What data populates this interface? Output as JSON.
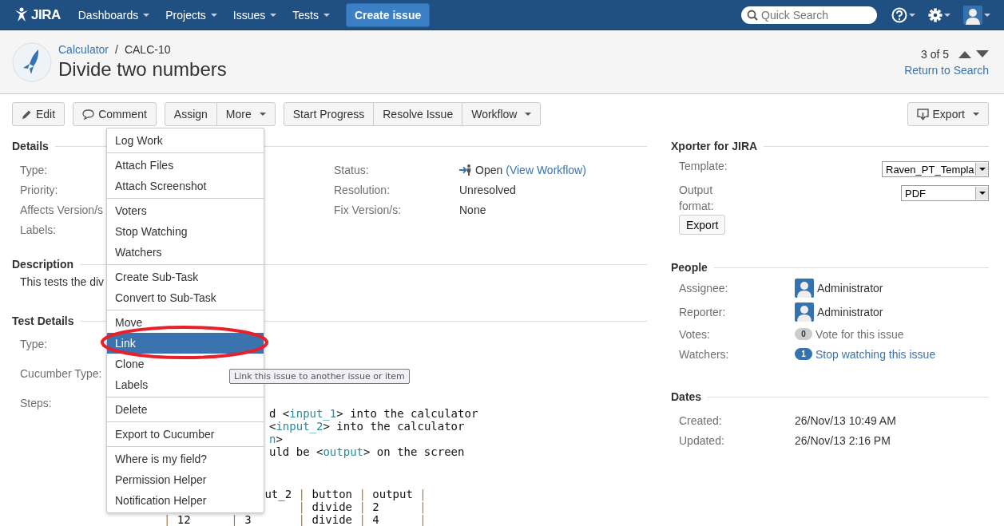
{
  "nav": {
    "logo": "JIRA",
    "items": [
      {
        "label": "Dashboards"
      },
      {
        "label": "Projects"
      },
      {
        "label": "Issues"
      },
      {
        "label": "Tests"
      }
    ],
    "create": "Create issue",
    "search": {
      "placeholder": "Quick Search"
    }
  },
  "header": {
    "project": "Calculator",
    "separator": "/",
    "key": "CALC-10",
    "title": "Divide two numbers",
    "pager": "3 of 5",
    "return_link": "Return to Search"
  },
  "toolbar": {
    "groups": [
      [
        {
          "label": "Edit",
          "kind": "edit",
          "dropdown": false
        }
      ],
      [
        {
          "label": "Comment",
          "kind": "comment",
          "dropdown": false
        }
      ],
      [
        {
          "label": "Assign",
          "dropdown": false
        },
        {
          "label": "More",
          "dropdown": true
        }
      ],
      [
        {
          "label": "Start Progress",
          "dropdown": false
        },
        {
          "label": "Resolve Issue",
          "dropdown": false
        },
        {
          "label": "Workflow",
          "dropdown": true
        }
      ]
    ],
    "export": {
      "label": "Export",
      "dropdown": true
    }
  },
  "details": {
    "heading": "Details",
    "left": [
      {
        "label": "Type:"
      },
      {
        "label": "Priority:"
      },
      {
        "label": "Affects Version/s"
      },
      {
        "label": "Labels:"
      }
    ],
    "right": [
      {
        "label": "Status:",
        "value": "Open",
        "link": "(View Workflow)",
        "kind": "status"
      },
      {
        "label": "Resolution:",
        "value": "Unresolved",
        "kind": "text"
      },
      {
        "label": "Fix Version/s:",
        "value": "None",
        "kind": "text"
      }
    ]
  },
  "description": {
    "heading": "Description",
    "text": "This tests the div"
  },
  "test_details": {
    "heading": "Test Details",
    "fields": [
      {
        "label": "Type:"
      },
      {
        "label": "Cucumber Type:"
      },
      {
        "label": "Steps:"
      }
    ],
    "steps": [
      {
        "kind": "step",
        "segments": [
          {
            "kind": "plain",
            "text": "d <"
          },
          {
            "kind": "var",
            "text": "input_1"
          },
          {
            "kind": "plain",
            "text": "> into the calculator"
          }
        ]
      },
      {
        "kind": "step",
        "segments": [
          {
            "kind": "plain",
            "text": "<"
          },
          {
            "kind": "var",
            "text": "input_2"
          },
          {
            "kind": "plain",
            "text": "> into the calculator"
          }
        ]
      },
      {
        "kind": "step",
        "segments": [
          {
            "kind": "var",
            "text": "n"
          },
          {
            "kind": "plain",
            "text": ">"
          }
        ]
      },
      {
        "kind": "step",
        "segments": [
          {
            "kind": "plain",
            "text": "uld be <"
          },
          {
            "kind": "var",
            "text": "output"
          },
          {
            "kind": "plain",
            "text": "> on the screen"
          }
        ]
      }
    ],
    "table": [
      [
        {
          "kind": "plain",
          "text": "ut_2 "
        },
        {
          "kind": "pipe",
          "text": "|"
        },
        {
          "kind": "plain",
          "text": " button "
        },
        {
          "kind": "pipe",
          "text": "|"
        },
        {
          "kind": "plain",
          "text": " output "
        },
        {
          "kind": "pipe",
          "text": "|"
        }
      ],
      [
        {
          "kind": "pipe",
          "text": "|"
        },
        {
          "kind": "plain",
          "text": " divide "
        },
        {
          "kind": "pipe",
          "text": "|"
        },
        {
          "kind": "plain",
          "text": " 2      "
        },
        {
          "kind": "pipe",
          "text": "|"
        }
      ],
      [
        {
          "kind": "pipe",
          "text": "|"
        },
        {
          "kind": "plain",
          "text": " 12      "
        },
        {
          "kind": "pipe",
          "text": "|"
        },
        {
          "kind": "plain",
          "text": " 3       "
        },
        {
          "kind": "pipe",
          "text": "|"
        },
        {
          "kind": "plain",
          "text": " divide "
        },
        {
          "kind": "pipe",
          "text": "|"
        },
        {
          "kind": "plain",
          "text": " 4      "
        },
        {
          "kind": "pipe",
          "text": "|"
        }
      ]
    ]
  },
  "more_menu": {
    "groups": [
      [
        {
          "label": "Log Work",
          "selected": false
        }
      ],
      [
        {
          "label": "Attach Files",
          "selected": false
        },
        {
          "label": "Attach Screenshot",
          "selected": false
        }
      ],
      [
        {
          "label": "Voters",
          "selected": false
        },
        {
          "label": "Stop Watching",
          "selected": false
        },
        {
          "label": "Watchers",
          "selected": false
        }
      ],
      [
        {
          "label": "Create Sub-Task",
          "selected": false
        },
        {
          "label": "Convert to Sub-Task",
          "selected": false
        }
      ],
      [
        {
          "label": "Move",
          "selected": false
        },
        {
          "label": "Link",
          "selected": true
        },
        {
          "label": "Clone",
          "selected": false
        },
        {
          "label": "Labels",
          "selected": false
        }
      ],
      [
        {
          "label": "Delete",
          "selected": false
        }
      ],
      [
        {
          "label": "Export to Cucumber",
          "selected": false
        }
      ],
      [
        {
          "label": "Where is my field?",
          "selected": false
        },
        {
          "label": "Permission Helper",
          "selected": false
        },
        {
          "label": "Notification Helper",
          "selected": false
        }
      ]
    ]
  },
  "tooltip": "Link this issue to another issue or item",
  "xporter": {
    "heading": "Xporter for JIRA",
    "template_label": "Template:",
    "template_value": "Raven_PT_Templa",
    "format_label": "Output format:",
    "format_value": "PDF",
    "button": "Export"
  },
  "people": {
    "heading": "People",
    "rows": [
      {
        "label": "Assignee:",
        "kind": "user",
        "value": "Administrator"
      },
      {
        "label": "Reporter:",
        "kind": "user",
        "value": "Administrator"
      },
      {
        "label": "Votes:",
        "kind": "votes",
        "count": "0",
        "value": "Vote for this issue"
      },
      {
        "label": "Watchers:",
        "kind": "watchers",
        "count": "1",
        "value": "Stop watching this issue"
      }
    ]
  },
  "dates": {
    "heading": "Dates",
    "rows": [
      {
        "label": "Created:",
        "value": "26/Nov/13 10:49 AM"
      },
      {
        "label": "Updated:",
        "value": "26/Nov/13 2:16 PM"
      }
    ]
  }
}
